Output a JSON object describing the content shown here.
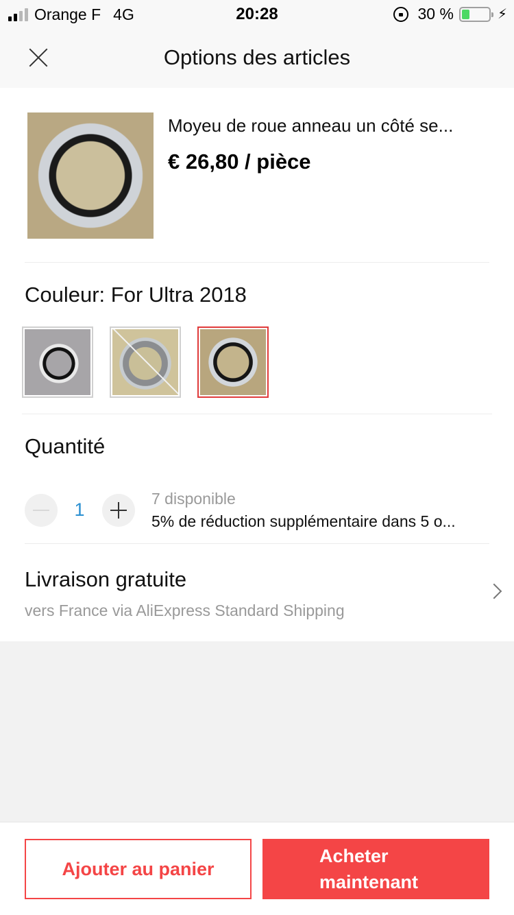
{
  "status_bar": {
    "carrier": "Orange F",
    "network": "4G",
    "time": "20:28",
    "battery_percent": "30 %",
    "battery_level": 0.3,
    "signal_bars_active": 2,
    "signal_bars_total": 4,
    "battery_color": "#4cd964"
  },
  "header": {
    "title": "Options des articles",
    "close_icon": "close-icon"
  },
  "product": {
    "title": "Moyeu de roue anneau un côté se...",
    "price": "€ 26,80 / pièce"
  },
  "color": {
    "label": "Couleur: For Ultra 2018",
    "options": [
      {
        "state": "available"
      },
      {
        "state": "unavailable"
      },
      {
        "state": "selected"
      }
    ],
    "selected_border_color": "#e03a3a"
  },
  "quantity": {
    "label": "Quantité",
    "value": "1",
    "stock": "7 disponible",
    "discount": "5% de réduction supplémentaire dans 5 o..."
  },
  "shipping": {
    "title": "Livraison gratuite",
    "subtitle": "vers France via AliExpress Standard Shipping"
  },
  "actions": {
    "add_to_cart": "Ajouter au panier",
    "buy_now_line1": "Acheter",
    "buy_now_line2": "maintenant",
    "accent_color": "#f44546"
  }
}
